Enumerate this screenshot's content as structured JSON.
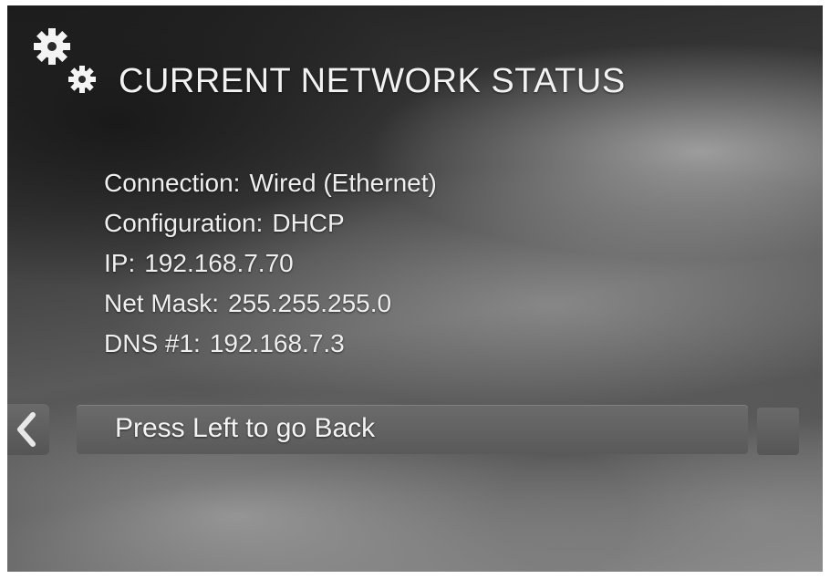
{
  "screen": {
    "title": "CURRENT NETWORK STATUS",
    "icon": "gears-icon"
  },
  "status": {
    "connection": {
      "label": "Connection:",
      "value": "Wired (Ethernet)"
    },
    "configuration": {
      "label": "Configuration:",
      "value": "DHCP"
    },
    "ip": {
      "label": "IP:",
      "value": "192.168.7.70"
    },
    "net_mask": {
      "label": "Net Mask:",
      "value": "255.255.255.0"
    },
    "dns1": {
      "label": "DNS #1:",
      "value": "192.168.7.3"
    }
  },
  "navigation": {
    "back_label": "Press Left to go Back",
    "back_icon": "chevron-left-icon"
  },
  "colors": {
    "text": "#f2f2f2",
    "bar": "#5f5f5f"
  }
}
